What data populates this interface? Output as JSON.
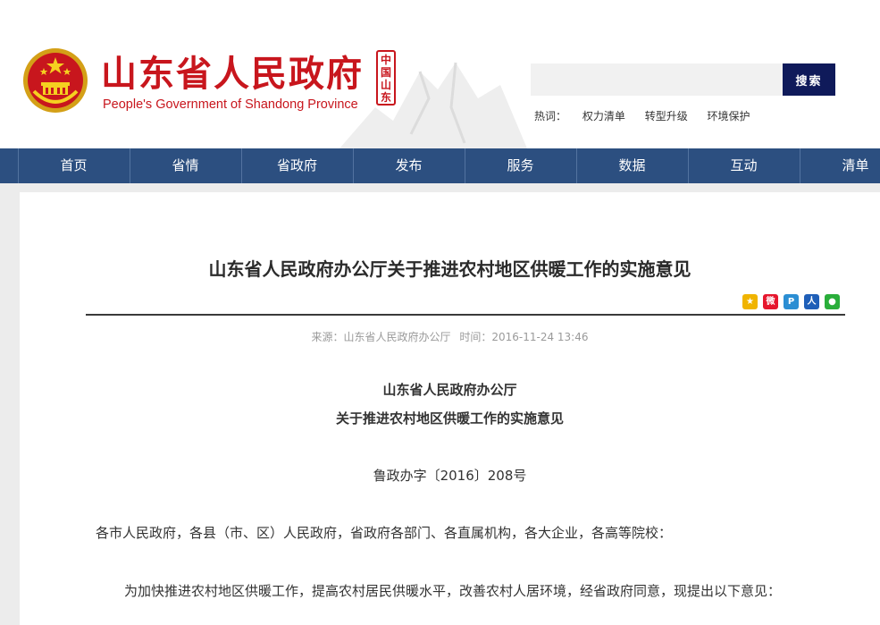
{
  "header": {
    "title_cn": "山东省人民政府",
    "title_en": "People's Government of Shandong Province",
    "seal_text": "中国山东",
    "brand_color": "#c8161d"
  },
  "search": {
    "placeholder": "",
    "button_label": "搜索",
    "hot_label": "热词：",
    "hot_words": [
      "权力清单",
      "转型升级",
      "环境保护"
    ]
  },
  "nav": {
    "items": [
      "首页",
      "省情",
      "省政府",
      "发布",
      "服务",
      "数据",
      "互动",
      "清单"
    ],
    "bg_color": "#2c4f80"
  },
  "article": {
    "title": "山东省人民政府办公厅关于推进农村地区供暖工作的实施意见",
    "source": "来源：山东省人民政府办公厅",
    "time": "时间：2016-11-24 13:46",
    "share_icons": [
      "qzone-icon",
      "weibo-icon",
      "tencent-weibo-icon",
      "renren-icon",
      "wechat-icon"
    ],
    "doc_org": "山东省人民政府办公厅",
    "doc_subtitle": "关于推进农村地区供暖工作的实施意见",
    "doc_number": "鲁政办字〔2016〕208号",
    "recipients": "各市人民政府，各县（市、区）人民政府，省政府各部门、各直属机构，各大企业，各高等院校：",
    "paragraph_1": "为加快推进农村地区供暖工作，提高农村居民供暖水平，改善农村人居环境，经省政府同意，现提出以下意见："
  }
}
